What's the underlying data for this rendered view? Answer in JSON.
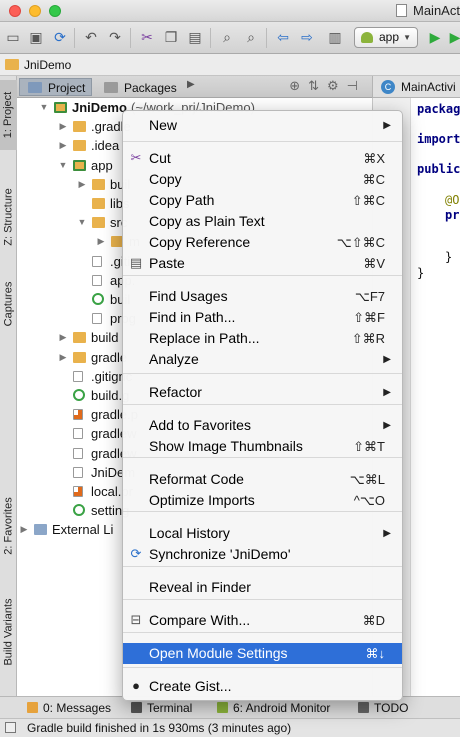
{
  "window": {
    "open_file": "MainActiv"
  },
  "toolbar": {
    "run_config": "app"
  },
  "breadcrumb": {
    "project": "JniDemo"
  },
  "left_tool_tabs": [
    "1: Project",
    "Z: Structure",
    "Captures",
    "2: Favorites",
    "Build Variants"
  ],
  "project_panel": {
    "tabs": [
      "Project",
      "Packages"
    ],
    "tree": [
      {
        "label": "JniDemo",
        "suffix": "(~/work_prj/JniDemo)",
        "arrow": "▼",
        "icon": "mod"
      },
      {
        "label": ".gradle",
        "arrow": "▶",
        "icon": "folder"
      },
      {
        "label": ".idea",
        "arrow": "▶",
        "icon": "folder"
      },
      {
        "label": "app",
        "arrow": "▼",
        "icon": "mod"
      },
      {
        "label": "buil",
        "arrow": "▶",
        "icon": "folder"
      },
      {
        "label": "libs",
        "arrow": "",
        "icon": "folder"
      },
      {
        "label": "src",
        "arrow": "▼",
        "icon": "folder"
      },
      {
        "label": "m",
        "arrow": "▶",
        "icon": "folder"
      },
      {
        "label": ".giti",
        "arrow": "",
        "icon": "file"
      },
      {
        "label": "app.",
        "arrow": "",
        "icon": "file"
      },
      {
        "label": "buil",
        "arrow": "",
        "icon": "gradle"
      },
      {
        "label": "prog",
        "arrow": "",
        "icon": "file"
      },
      {
        "label": "build",
        "arrow": "▶",
        "icon": "folder"
      },
      {
        "label": "gradle",
        "arrow": "▶",
        "icon": "folder"
      },
      {
        "label": ".gitignc",
        "arrow": "",
        "icon": "file"
      },
      {
        "label": "build.g",
        "arrow": "",
        "icon": "gradle"
      },
      {
        "label": "gradle.p",
        "arrow": "",
        "icon": "orange"
      },
      {
        "label": "gradlew",
        "arrow": "",
        "icon": "file"
      },
      {
        "label": "gradlew",
        "arrow": "",
        "icon": "file"
      },
      {
        "label": "JniDem",
        "arrow": "",
        "icon": "file"
      },
      {
        "label": "local.pr",
        "arrow": "",
        "icon": "orange"
      },
      {
        "label": "setting",
        "arrow": "",
        "icon": "gradle"
      },
      {
        "label": "External Li",
        "arrow": "▶",
        "icon": "ext"
      }
    ]
  },
  "editor": {
    "tab": "MainActivi",
    "lines": [
      {
        "text": "package",
        "kind": "kw"
      },
      {
        "text": "import",
        "kind": "kw"
      },
      {
        "text": "public",
        "kind": "kw"
      },
      {
        "text": "@Ov",
        "kind": "anno"
      },
      {
        "text": "pro",
        "kind": "kw"
      },
      {
        "text": "}",
        "kind": "plain"
      },
      {
        "text": "}",
        "kind": "plain"
      }
    ]
  },
  "context_menu": {
    "items": [
      {
        "label": "New",
        "shortcut": "",
        "submenu": true,
        "icon": ""
      },
      {
        "label": "Cut",
        "shortcut": "⌘X",
        "submenu": false,
        "icon": "scissors"
      },
      {
        "label": "Copy",
        "shortcut": "⌘C",
        "submenu": false,
        "icon": ""
      },
      {
        "label": "Copy Path",
        "shortcut": "⇧⌘C",
        "submenu": false,
        "icon": ""
      },
      {
        "label": "Copy as Plain Text",
        "shortcut": "",
        "submenu": false,
        "icon": ""
      },
      {
        "label": "Copy Reference",
        "shortcut": "⌥⇧⌘C",
        "submenu": false,
        "icon": ""
      },
      {
        "label": "Paste",
        "shortcut": "⌘V",
        "submenu": false,
        "icon": "clipboard"
      },
      {
        "label": "Find Usages",
        "shortcut": "⌥F7",
        "submenu": false,
        "icon": ""
      },
      {
        "label": "Find in Path...",
        "shortcut": "⇧⌘F",
        "submenu": false,
        "icon": ""
      },
      {
        "label": "Replace in Path...",
        "shortcut": "⇧⌘R",
        "submenu": false,
        "icon": ""
      },
      {
        "label": "Analyze",
        "shortcut": "",
        "submenu": true,
        "icon": ""
      },
      {
        "label": "Refactor",
        "shortcut": "",
        "submenu": true,
        "icon": ""
      },
      {
        "label": "Add to Favorites",
        "shortcut": "",
        "submenu": true,
        "icon": ""
      },
      {
        "label": "Show Image Thumbnails",
        "shortcut": "⇧⌘T",
        "submenu": false,
        "icon": ""
      },
      {
        "label": "Reformat Code",
        "shortcut": "⌥⌘L",
        "submenu": false,
        "icon": ""
      },
      {
        "label": "Optimize Imports",
        "shortcut": "^⌥O",
        "submenu": false,
        "icon": ""
      },
      {
        "label": "Local History",
        "shortcut": "",
        "submenu": true,
        "icon": ""
      },
      {
        "label": "Synchronize 'JniDemo'",
        "shortcut": "",
        "submenu": false,
        "icon": "sync"
      },
      {
        "label": "Reveal in Finder",
        "shortcut": "",
        "submenu": false,
        "icon": ""
      },
      {
        "label": "Compare With...",
        "shortcut": "⌘D",
        "submenu": false,
        "icon": "compare"
      },
      {
        "label": "Open Module Settings",
        "shortcut": "⌘↓",
        "submenu": false,
        "icon": "",
        "highlighted": true
      },
      {
        "label": "Create Gist...",
        "shortcut": "",
        "submenu": false,
        "icon": "github"
      }
    ]
  },
  "bottom_tabs": [
    {
      "label": "0: Messages",
      "color": "#e6a23c"
    },
    {
      "label": "Terminal",
      "color": "#555555"
    },
    {
      "label": "6: Android Monitor",
      "color": "#8cb43c"
    },
    {
      "label": "TODO",
      "color": "#666666"
    }
  ],
  "status": {
    "message": "Gradle build finished in 1s 930ms (3 minutes ago)"
  }
}
